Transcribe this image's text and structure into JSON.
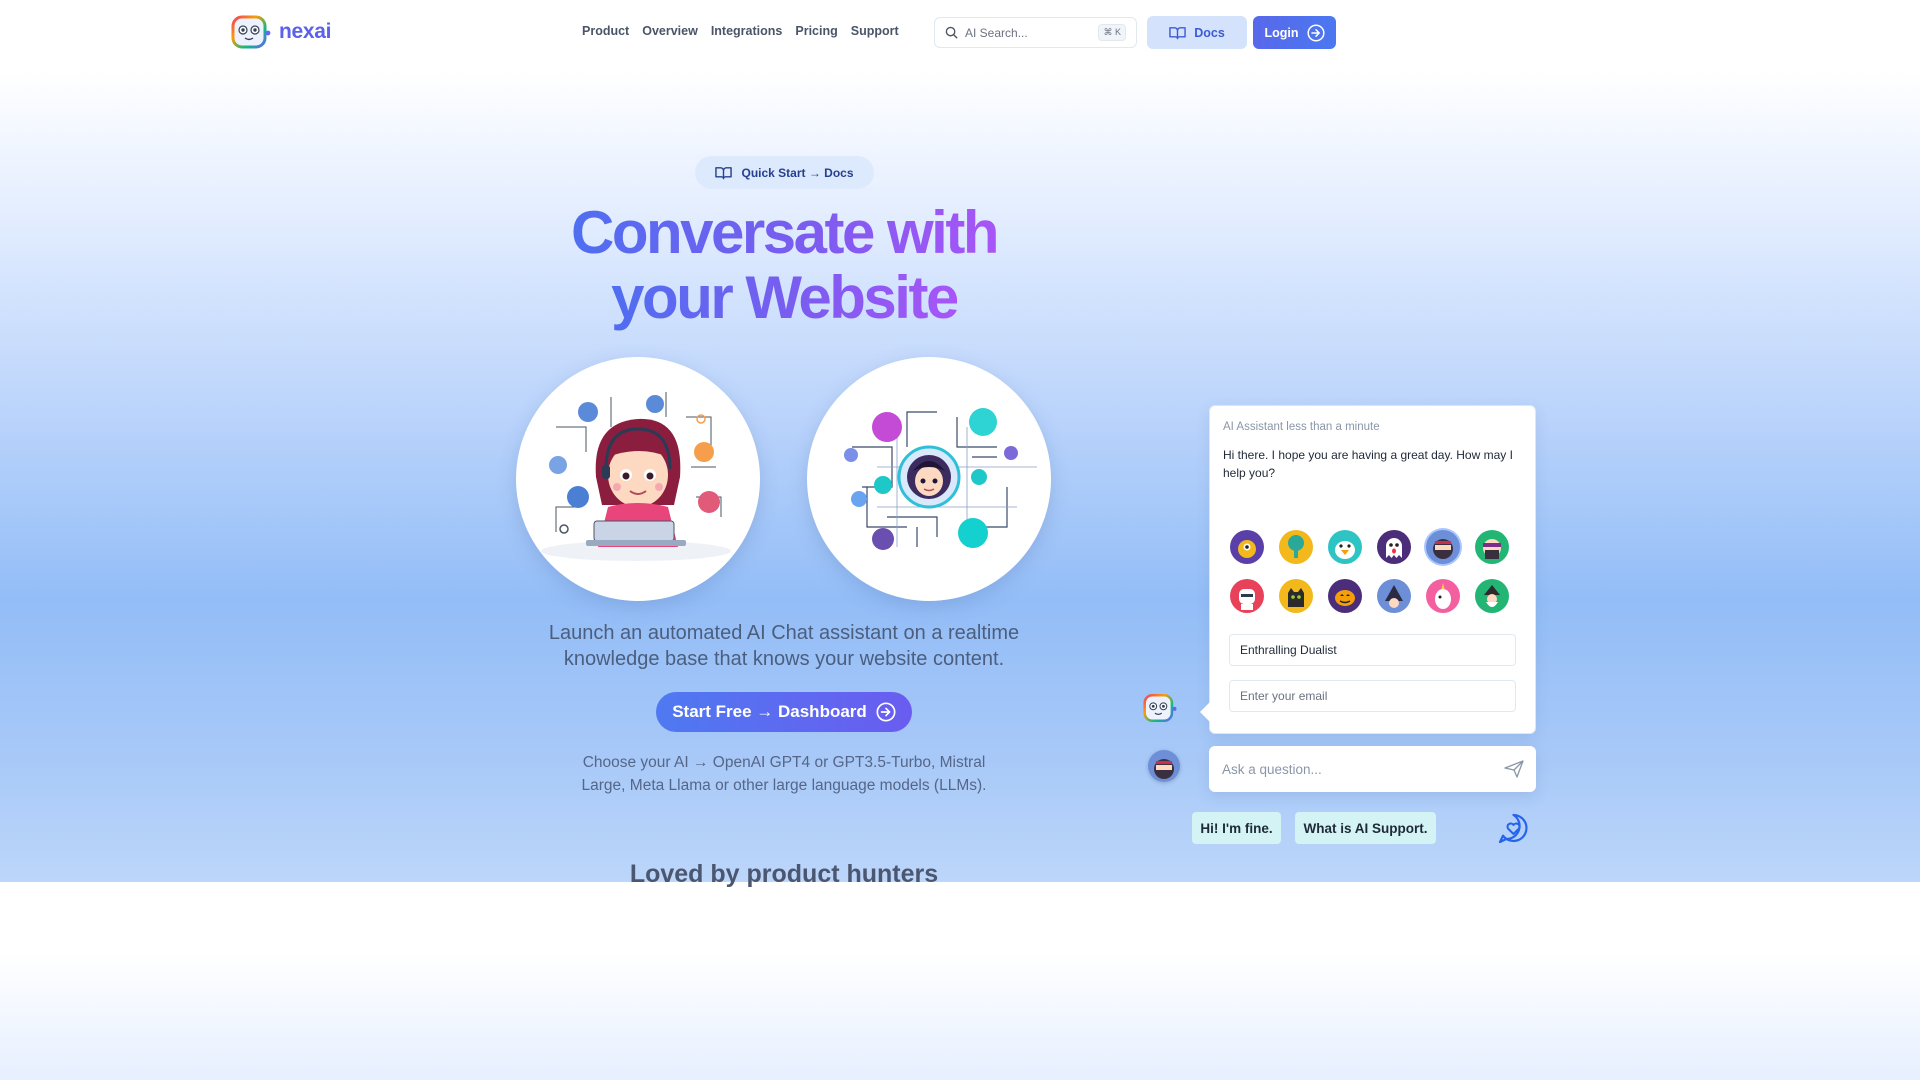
{
  "brand": {
    "name": "nexai"
  },
  "nav": {
    "items": [
      {
        "label": "Product"
      },
      {
        "label": "Overview"
      },
      {
        "label": "Integrations"
      },
      {
        "label": "Pricing"
      },
      {
        "label": "Support"
      }
    ],
    "search": {
      "placeholder": "AI Search...",
      "shortcut": "⌘ K"
    },
    "docs_label": "Docs",
    "login_label": "Login"
  },
  "hero": {
    "pill": "Quick Start → Docs",
    "headline_line1": "Conversate with",
    "headline_line2": "your Website",
    "subtitle": "Launch an automated AI Chat assistant on a realtime knowledge base that knows your website content.",
    "cta": "Start Free → Dashboard",
    "models": "Choose your AI → OpenAI GPT4 or GPT3.5-Turbo, Mistral Large, Meta Llama or other large language models (LLMs).",
    "section_heading": "Loved by product hunters"
  },
  "chat": {
    "meta": "AI Assistant less than a minute",
    "greeting": "Hi there. I hope you are having a great day. How may I help you?",
    "avatars": [
      {
        "icon": "monster-avatar-icon",
        "color": "#5b3fa8"
      },
      {
        "icon": "tree-avatar-icon",
        "color": "#f2b81c"
      },
      {
        "icon": "bird-avatar-icon",
        "color": "#2ec4c4"
      },
      {
        "icon": "ghost-avatar-icon",
        "color": "#4b2d7a"
      },
      {
        "icon": "ninja-avatar-icon",
        "color": "#6d8fd8"
      },
      {
        "icon": "bandit-avatar-icon",
        "color": "#22b573"
      },
      {
        "icon": "robot-avatar-icon",
        "color": "#e8425a"
      },
      {
        "icon": "cat-avatar-icon",
        "color": "#f2b81c"
      },
      {
        "icon": "pumpkin-avatar-icon",
        "color": "#4b2d7a"
      },
      {
        "icon": "witch-avatar-icon",
        "color": "#6d8fd8"
      },
      {
        "icon": "unicorn-avatar-icon",
        "color": "#f45fa0"
      },
      {
        "icon": "wizard-avatar-icon",
        "color": "#22b573"
      }
    ],
    "name_value": "Enthralling Dualist",
    "email_placeholder": "Enter your email",
    "ask_placeholder": "Ask a question...",
    "suggestions": [
      "Hi! I'm fine.",
      "What is AI Support."
    ]
  },
  "colors": {
    "brand": "#5b61e8",
    "cta_start": "#4f79f1",
    "cta_end": "#6a5cf0",
    "suggestion_bg": "#d3f3f5"
  }
}
